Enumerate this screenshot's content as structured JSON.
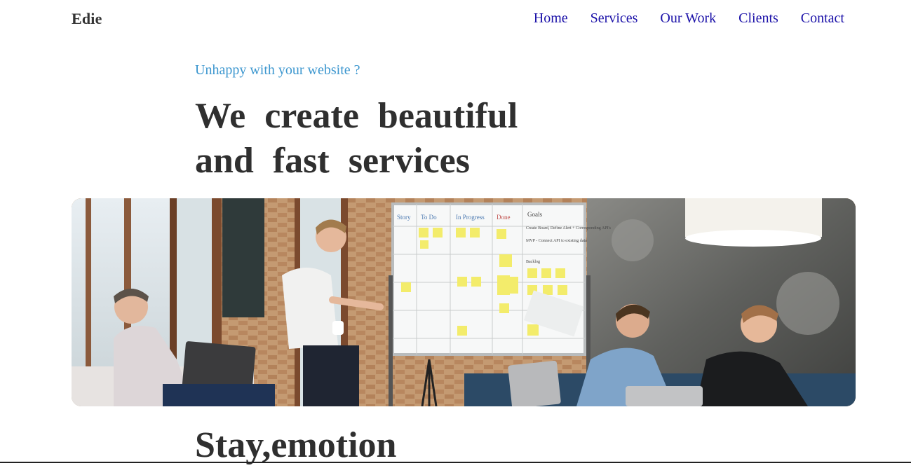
{
  "brand": "Edie",
  "nav": {
    "items": [
      "Home",
      "Services",
      "Our Work",
      "Clients",
      "Contact"
    ]
  },
  "hero": {
    "kicker": "Unhappy with your website ?",
    "headline_line1": "We create beautiful",
    "headline_line2": "and fast services",
    "image_alt": "Team meeting around a whiteboard with sticky notes"
  },
  "whiteboard": {
    "columns": [
      "Story",
      "To Do",
      "In Progress",
      "Done",
      "Goals"
    ],
    "notes": [
      "Create Board, Define Alert + Corresponding API's",
      "MVP - Connect API to existing data",
      "Backlog"
    ]
  },
  "section2": {
    "title": "Stay,emotion"
  },
  "colors": {
    "nav_link": "#1a10a8",
    "kicker": "#3d97cf",
    "heading": "#2f2f2f"
  }
}
